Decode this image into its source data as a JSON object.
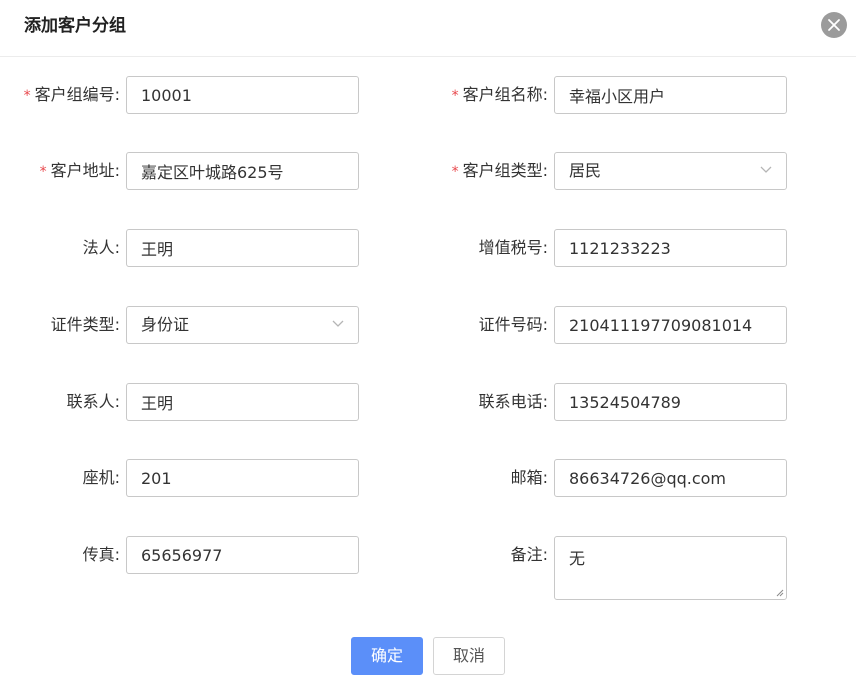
{
  "dialog": {
    "title": "添加客户分组",
    "ok_label": "确定",
    "cancel_label": "取消"
  },
  "form": {
    "customer_group_no": {
      "label": "客户组编号:",
      "required": true,
      "value": "10001"
    },
    "customer_group_name": {
      "label": "客户组名称:",
      "required": true,
      "value": "幸福小区用户"
    },
    "customer_address": {
      "label": "客户地址:",
      "required": true,
      "value": "嘉定区叶城路625号"
    },
    "customer_group_type": {
      "label": "客户组类型:",
      "required": true,
      "value": "居民"
    },
    "legal_person": {
      "label": "法人:",
      "value": "王明"
    },
    "vat_no": {
      "label": "增值税号:",
      "value": "1121233223"
    },
    "id_type": {
      "label": "证件类型:",
      "value": "身份证"
    },
    "id_no": {
      "label": "证件号码:",
      "value": "210411197709081014"
    },
    "contact": {
      "label": "联系人:",
      "value": "王明"
    },
    "contact_phone": {
      "label": "联系电话:",
      "value": "13524504789"
    },
    "landline": {
      "label": "座机:",
      "value": "201"
    },
    "email": {
      "label": "邮箱:",
      "value": "86634726@qq.com"
    },
    "fax": {
      "label": "传真:",
      "value": "65656977"
    },
    "remark": {
      "label": "备注:",
      "value": "无"
    }
  },
  "required_mark": "*",
  "colors": {
    "primary": "#5b8ff9",
    "required": "#e8474c",
    "close_bg": "#9b9b9b"
  },
  "icons": {
    "close": "close-icon",
    "dropdown": "chevron-down-icon"
  }
}
